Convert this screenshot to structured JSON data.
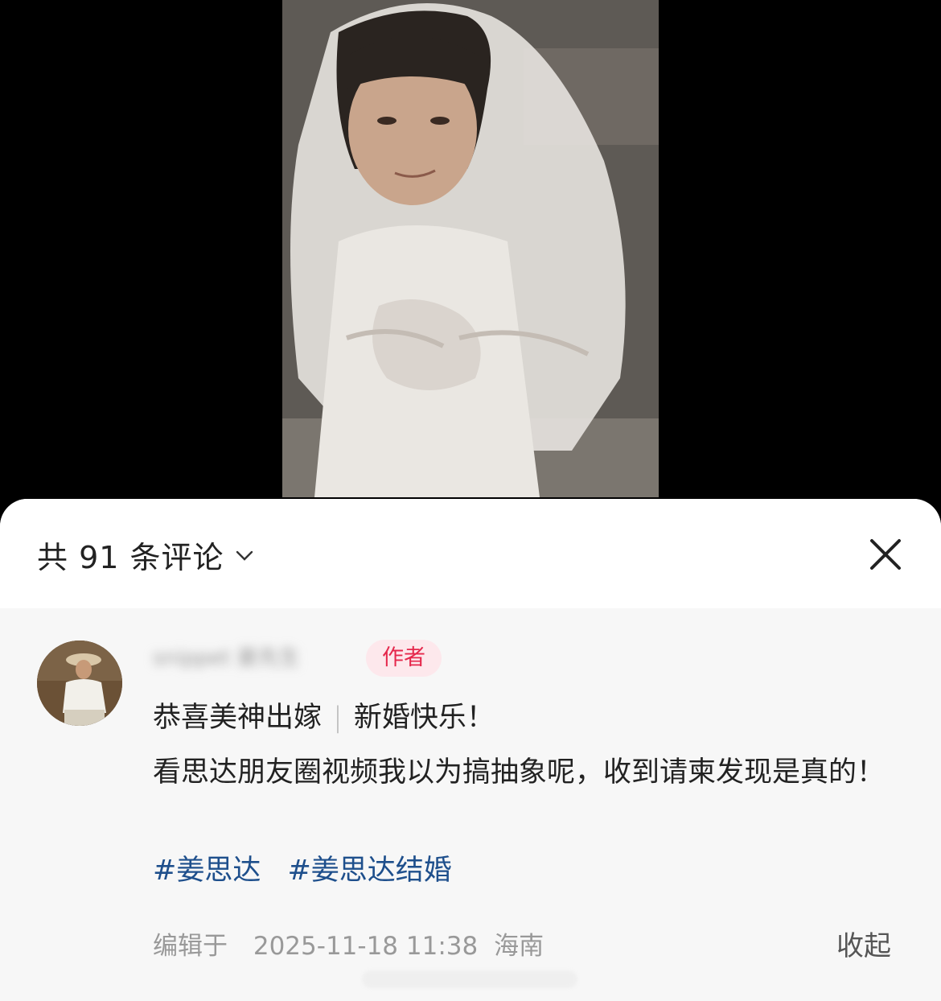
{
  "video": {
    "background": "#000000"
  },
  "comments_sheet": {
    "count_label": "共 91 条评论",
    "close_icon": "close-icon",
    "expand_icon": "chevron-down-icon"
  },
  "comment": {
    "username": "snippet 姜先生",
    "badge": "作者",
    "lines": [
      "恭喜美神出嫁",
      "新婚快乐！",
      "看思达朋友圈视频我以为搞抽象呢，收到请柬发现是真的！"
    ],
    "tags": [
      "#姜思达",
      "#姜思达结婚"
    ],
    "meta": {
      "edited_label": "编辑于",
      "time": "2025-11-18 11:38",
      "location": "海南"
    },
    "collapse_label": "收起"
  },
  "colors": {
    "badge_text": "#e5284c",
    "badge_bg": "#fde8ec",
    "tag": "#1e4f8c",
    "sheet_bg": "#f7f7f7"
  }
}
